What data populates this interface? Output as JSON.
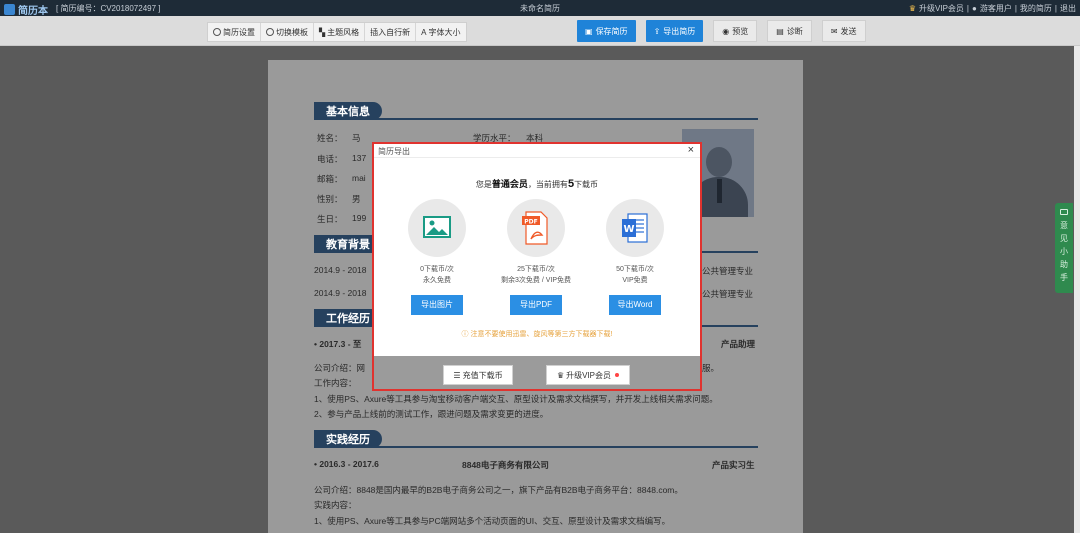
{
  "app": {
    "logo": "简历本",
    "cv_number": "[ 简历编号：CV2018072497 ]",
    "document_title": "未命名简历",
    "top_links": [
      "升级VIP会员",
      "游客用户",
      "我的简历",
      "退出"
    ]
  },
  "toolbar": {
    "tools": [
      "简历设置",
      "切换模板",
      "主题风格",
      "插入自行新",
      "字体大小"
    ],
    "save_label": "保存简历",
    "export_label": "导出简历",
    "preview_label": "预览",
    "diagnose_label": "诊断",
    "send_label": "发送"
  },
  "resume": {
    "basic_title": "基本信息",
    "edu_title": "教育背景",
    "work_title": "工作经历",
    "practice_title": "实践经历",
    "fields": [
      {
        "label": "姓名：",
        "value": "马"
      },
      {
        "label": "电话：",
        "value": "137"
      },
      {
        "label": "邮箱：",
        "value": "mai"
      },
      {
        "label": "性别：",
        "value": "男"
      },
      {
        "label": "生日：",
        "value": "199"
      }
    ],
    "degree_label": "学历水平：",
    "degree_value": "本科",
    "edu_rows": [
      "2014.9 - 2018",
      "2014.9 - 2018"
    ],
    "edu_major": "公共管理专业",
    "work_period": "• 2017.3 - 至",
    "work_role": "产品助理",
    "work_lines": [
      "公司介绍：网",
      "工作内容：",
      "1、使用PS、Axure等工具参与淘宝移动客户端交互、原型设计及需求文档撰写，并开发上线相关需求问题。",
      "2、参与产品上线前的测试工作，跟进问题及需求变更的进度。"
    ],
    "work_tail": "服。",
    "practice_period": "• 2016.3 - 2017.6",
    "practice_company": "8848电子商务有限公司",
    "practice_role": "产品实习生",
    "practice_lines": [
      "公司介绍：8848是国内最早的B2B电子商务公司之一，旗下产品有B2B电子商务平台：8848.com。",
      "实践内容：",
      "1、使用PS、Axure等工具参与PC端网站多个活动页面的UI、交互、原型设计及需求文档编写。"
    ]
  },
  "modal": {
    "title": "简历导出",
    "close": "×",
    "member_prefix": "您是",
    "member_type": "普通会员",
    "member_middle": "，当前拥有",
    "coin_count": "5",
    "member_suffix": "下载币",
    "options": [
      {
        "cost": "0下载币/次",
        "note": "永久免费",
        "button": "导出图片",
        "icon": "image-icon",
        "color": "#1a9b85"
      },
      {
        "cost": "25下载币/次",
        "note": "剩余3次免费 / VIP免费",
        "button": "导出PDF",
        "icon": "pdf-icon",
        "color": "#f05a28"
      },
      {
        "cost": "50下载币/次",
        "note": "VIP免费",
        "button": "导出Word",
        "icon": "word-icon",
        "color": "#2b6fd6"
      }
    ],
    "notice": "注意不要使用迅雷、旋风等第三方下载器下载!",
    "recharge_label": "充值下载币",
    "upgrade_label": "升级VIP会员"
  },
  "side_tab": {
    "label_chars": [
      "意",
      "见",
      "小",
      "助",
      "手"
    ]
  }
}
